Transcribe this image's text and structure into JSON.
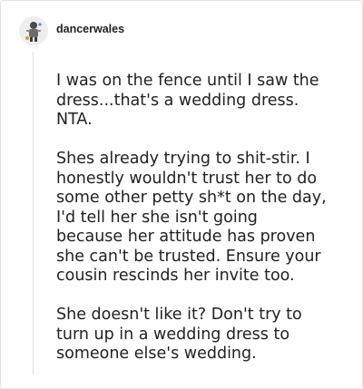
{
  "post": {
    "username": "dancerwales",
    "paragraphs": [
      "I was on the fence until I saw the\ndress...that's a wedding dress.\nNTA.",
      "Shes already trying to shit-stir. I\nhonestly wouldn't trust her to do\nsome other petty sh*t on the day,\nI'd tell her she isn't going\nbecause her attitude has proven\nshe can't be trusted. Ensure your\ncousin rescinds her invite too.",
      "She doesn't like it? Don't try to\nturn up in a wedding dress to\nsomeone else's wedding."
    ]
  },
  "icons": {
    "avatar": "user-avatar-icon"
  }
}
